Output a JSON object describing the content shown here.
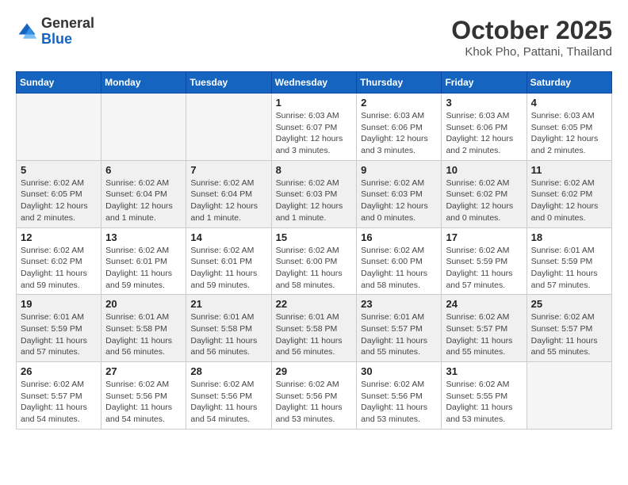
{
  "logo": {
    "general": "General",
    "blue": "Blue"
  },
  "title": "October 2025",
  "location": "Khok Pho, Pattani, Thailand",
  "days_of_week": [
    "Sunday",
    "Monday",
    "Tuesday",
    "Wednesday",
    "Thursday",
    "Friday",
    "Saturday"
  ],
  "weeks": [
    [
      {
        "day": "",
        "info": ""
      },
      {
        "day": "",
        "info": ""
      },
      {
        "day": "",
        "info": ""
      },
      {
        "day": "1",
        "info": "Sunrise: 6:03 AM\nSunset: 6:07 PM\nDaylight: 12 hours\nand 3 minutes."
      },
      {
        "day": "2",
        "info": "Sunrise: 6:03 AM\nSunset: 6:06 PM\nDaylight: 12 hours\nand 3 minutes."
      },
      {
        "day": "3",
        "info": "Sunrise: 6:03 AM\nSunset: 6:06 PM\nDaylight: 12 hours\nand 2 minutes."
      },
      {
        "day": "4",
        "info": "Sunrise: 6:03 AM\nSunset: 6:05 PM\nDaylight: 12 hours\nand 2 minutes."
      }
    ],
    [
      {
        "day": "5",
        "info": "Sunrise: 6:02 AM\nSunset: 6:05 PM\nDaylight: 12 hours\nand 2 minutes."
      },
      {
        "day": "6",
        "info": "Sunrise: 6:02 AM\nSunset: 6:04 PM\nDaylight: 12 hours\nand 1 minute."
      },
      {
        "day": "7",
        "info": "Sunrise: 6:02 AM\nSunset: 6:04 PM\nDaylight: 12 hours\nand 1 minute."
      },
      {
        "day": "8",
        "info": "Sunrise: 6:02 AM\nSunset: 6:03 PM\nDaylight: 12 hours\nand 1 minute."
      },
      {
        "day": "9",
        "info": "Sunrise: 6:02 AM\nSunset: 6:03 PM\nDaylight: 12 hours\nand 0 minutes."
      },
      {
        "day": "10",
        "info": "Sunrise: 6:02 AM\nSunset: 6:02 PM\nDaylight: 12 hours\nand 0 minutes."
      },
      {
        "day": "11",
        "info": "Sunrise: 6:02 AM\nSunset: 6:02 PM\nDaylight: 12 hours\nand 0 minutes."
      }
    ],
    [
      {
        "day": "12",
        "info": "Sunrise: 6:02 AM\nSunset: 6:02 PM\nDaylight: 11 hours\nand 59 minutes."
      },
      {
        "day": "13",
        "info": "Sunrise: 6:02 AM\nSunset: 6:01 PM\nDaylight: 11 hours\nand 59 minutes."
      },
      {
        "day": "14",
        "info": "Sunrise: 6:02 AM\nSunset: 6:01 PM\nDaylight: 11 hours\nand 59 minutes."
      },
      {
        "day": "15",
        "info": "Sunrise: 6:02 AM\nSunset: 6:00 PM\nDaylight: 11 hours\nand 58 minutes."
      },
      {
        "day": "16",
        "info": "Sunrise: 6:02 AM\nSunset: 6:00 PM\nDaylight: 11 hours\nand 58 minutes."
      },
      {
        "day": "17",
        "info": "Sunrise: 6:02 AM\nSunset: 5:59 PM\nDaylight: 11 hours\nand 57 minutes."
      },
      {
        "day": "18",
        "info": "Sunrise: 6:01 AM\nSunset: 5:59 PM\nDaylight: 11 hours\nand 57 minutes."
      }
    ],
    [
      {
        "day": "19",
        "info": "Sunrise: 6:01 AM\nSunset: 5:59 PM\nDaylight: 11 hours\nand 57 minutes."
      },
      {
        "day": "20",
        "info": "Sunrise: 6:01 AM\nSunset: 5:58 PM\nDaylight: 11 hours\nand 56 minutes."
      },
      {
        "day": "21",
        "info": "Sunrise: 6:01 AM\nSunset: 5:58 PM\nDaylight: 11 hours\nand 56 minutes."
      },
      {
        "day": "22",
        "info": "Sunrise: 6:01 AM\nSunset: 5:58 PM\nDaylight: 11 hours\nand 56 minutes."
      },
      {
        "day": "23",
        "info": "Sunrise: 6:01 AM\nSunset: 5:57 PM\nDaylight: 11 hours\nand 55 minutes."
      },
      {
        "day": "24",
        "info": "Sunrise: 6:02 AM\nSunset: 5:57 PM\nDaylight: 11 hours\nand 55 minutes."
      },
      {
        "day": "25",
        "info": "Sunrise: 6:02 AM\nSunset: 5:57 PM\nDaylight: 11 hours\nand 55 minutes."
      }
    ],
    [
      {
        "day": "26",
        "info": "Sunrise: 6:02 AM\nSunset: 5:57 PM\nDaylight: 11 hours\nand 54 minutes."
      },
      {
        "day": "27",
        "info": "Sunrise: 6:02 AM\nSunset: 5:56 PM\nDaylight: 11 hours\nand 54 minutes."
      },
      {
        "day": "28",
        "info": "Sunrise: 6:02 AM\nSunset: 5:56 PM\nDaylight: 11 hours\nand 54 minutes."
      },
      {
        "day": "29",
        "info": "Sunrise: 6:02 AM\nSunset: 5:56 PM\nDaylight: 11 hours\nand 53 minutes."
      },
      {
        "day": "30",
        "info": "Sunrise: 6:02 AM\nSunset: 5:56 PM\nDaylight: 11 hours\nand 53 minutes."
      },
      {
        "day": "31",
        "info": "Sunrise: 6:02 AM\nSunset: 5:55 PM\nDaylight: 11 hours\nand 53 minutes."
      },
      {
        "day": "",
        "info": ""
      }
    ]
  ]
}
